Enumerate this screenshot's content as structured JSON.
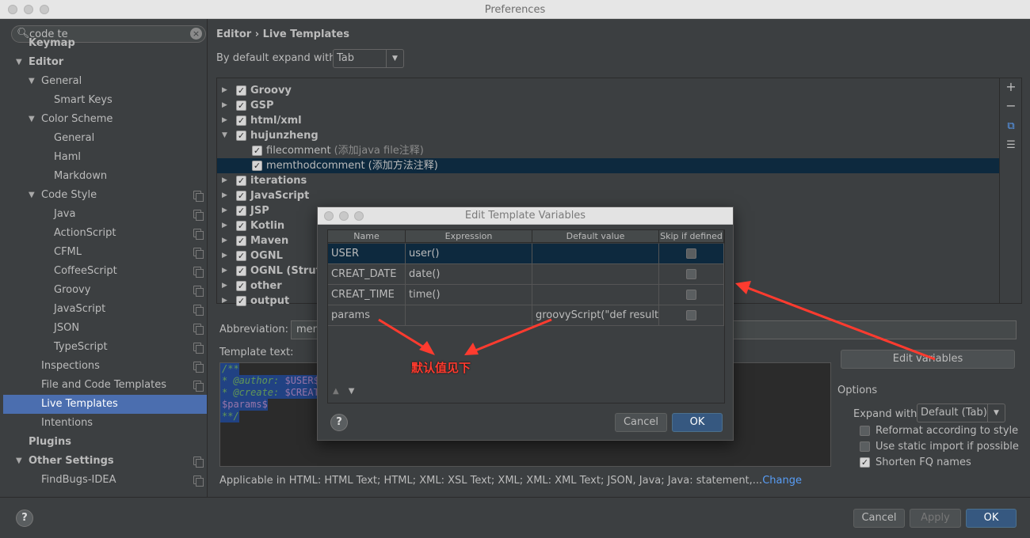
{
  "window": {
    "title": "Preferences"
  },
  "search": {
    "value": "code te",
    "icon": "search-icon",
    "clear_icon": "close-icon"
  },
  "sidebar": {
    "items": [
      {
        "label": "Keymap",
        "level": 0,
        "bold": true
      },
      {
        "label": "Editor",
        "level": 0,
        "bold": true,
        "expanded": true
      },
      {
        "label": "General",
        "level": 1,
        "expanded": true
      },
      {
        "label": "Smart Keys",
        "level": 2
      },
      {
        "label": "Color Scheme",
        "level": 1,
        "expanded": true
      },
      {
        "label": "General",
        "level": 2
      },
      {
        "label": "Haml",
        "level": 2
      },
      {
        "label": "Markdown",
        "level": 2
      },
      {
        "label": "Code Style",
        "level": 1,
        "expanded": true,
        "config": true
      },
      {
        "label": "Java",
        "level": 2,
        "config": true
      },
      {
        "label": "ActionScript",
        "level": 2,
        "config": true
      },
      {
        "label": "CFML",
        "level": 2,
        "config": true
      },
      {
        "label": "CoffeeScript",
        "level": 2,
        "config": true
      },
      {
        "label": "Groovy",
        "level": 2,
        "config": true
      },
      {
        "label": "JavaScript",
        "level": 2,
        "config": true
      },
      {
        "label": "JSON",
        "level": 2,
        "config": true
      },
      {
        "label": "TypeScript",
        "level": 2,
        "config": true
      },
      {
        "label": "Inspections",
        "level": 1,
        "config": true
      },
      {
        "label": "File and Code Templates",
        "level": 1,
        "config": true
      },
      {
        "label": "Live Templates",
        "level": 1,
        "selected": true
      },
      {
        "label": "Intentions",
        "level": 1
      },
      {
        "label": "Plugins",
        "level": 0,
        "bold": true
      },
      {
        "label": "Other Settings",
        "level": 0,
        "bold": true,
        "expanded": true,
        "config": true
      },
      {
        "label": "FindBugs-IDEA",
        "level": 1,
        "config": true
      }
    ]
  },
  "breadcrumb": {
    "parent": "Editor",
    "sep": "›",
    "current": "Live Templates"
  },
  "expand": {
    "label": "By default expand with",
    "value": "Tab"
  },
  "templates": [
    {
      "name": "Groovy",
      "level": 0,
      "expanded": false
    },
    {
      "name": "GSP",
      "level": 0,
      "expanded": false
    },
    {
      "name": "html/xml",
      "level": 0,
      "expanded": false
    },
    {
      "name": "hujunzheng",
      "level": 0,
      "expanded": true
    },
    {
      "name": "filecomment",
      "desc": "(添加java file注释)",
      "level": 1
    },
    {
      "name": "memthodcomment",
      "desc": "(添加方法注释)",
      "level": 1,
      "selected": true
    },
    {
      "name": "iterations",
      "level": 0,
      "expanded": false
    },
    {
      "name": "JavaScript",
      "level": 0,
      "expanded": false
    },
    {
      "name": "JSP",
      "level": 0,
      "expanded": false
    },
    {
      "name": "Kotlin",
      "level": 0,
      "expanded": false
    },
    {
      "name": "Maven",
      "level": 0,
      "expanded": false
    },
    {
      "name": "OGNL",
      "level": 0,
      "expanded": false
    },
    {
      "name": "OGNL (Struts",
      "level": 0,
      "expanded": false
    },
    {
      "name": "other",
      "level": 0,
      "expanded": false
    },
    {
      "name": "output",
      "level": 0,
      "expanded": false
    }
  ],
  "side_tools": {
    "add": "+",
    "remove": "−",
    "copy": "copy-icon",
    "list": "list-icon"
  },
  "abbreviation": {
    "label": "Abbreviation:",
    "value": "mem"
  },
  "template_text": {
    "label": "Template text:",
    "lines": [
      {
        "text": "/**"
      },
      {
        "text": "* @author: ",
        "var": "$USER$"
      },
      {
        "text": "* @create: ",
        "var": "$CREAT_"
      },
      {
        "var": "$params$"
      },
      {
        "text": "**/"
      }
    ]
  },
  "edit_variables_label": "Edit variables",
  "options": {
    "title": "Options",
    "expand_label": "Expand with",
    "expand_value": "Default (Tab)",
    "checks": [
      {
        "label": "Reformat according to style",
        "checked": false
      },
      {
        "label": "Use static import if possible",
        "checked": false
      },
      {
        "label": "Shorten FQ names",
        "checked": true
      }
    ]
  },
  "applicable": {
    "text": "Applicable in HTML: HTML Text; HTML; XML: XSL Text; XML; XML: XML Text; JSON, Java; Java: statement,...",
    "link": "Change"
  },
  "footer": {
    "cancel": "Cancel",
    "apply": "Apply",
    "ok": "OK",
    "help": "?"
  },
  "dialog": {
    "title": "Edit Template Variables",
    "columns": [
      "Name",
      "Expression",
      "Default value",
      "Skip if defined"
    ],
    "rows": [
      {
        "name": "USER",
        "expression": "user()",
        "default": "",
        "skip": false
      },
      {
        "name": "CREAT_DATE",
        "expression": "date()",
        "default": "",
        "skip": false
      },
      {
        "name": "CREAT_TIME",
        "expression": "time()",
        "default": "",
        "skip": false
      },
      {
        "name": "params",
        "expression": "",
        "default": "groovyScript(\"def result=",
        "skip": false
      }
    ],
    "cancel": "Cancel",
    "ok": "OK",
    "help": "?"
  },
  "annotation": {
    "text": "默认值见下",
    "color": "#ff3b2f"
  }
}
